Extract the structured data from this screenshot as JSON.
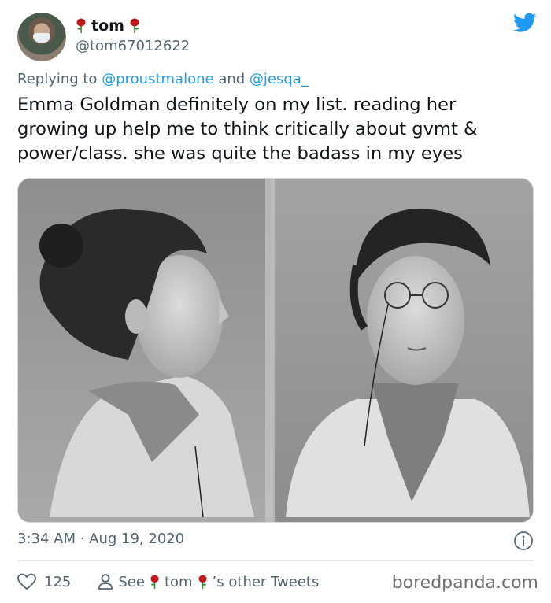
{
  "user": {
    "name": "tom",
    "handle": "@tom67012622",
    "avatar": "avatar-icon",
    "name_emoji": "rose-icon"
  },
  "reply": {
    "prefix": "Replying to",
    "mention1": "@proustmalone",
    "conjunction": "and",
    "mention2": "@jesqa_"
  },
  "tweet": {
    "lines": [
      "Emma Goldman definitely on my list.  reading her",
      "growing up help me to think critically about gvmt &",
      "power/class.  she was quite the badass in my eyes"
    ],
    "image": "photo-icon"
  },
  "meta": {
    "timestamp": "3:34 AM · Aug 19, 2020"
  },
  "actions": {
    "likes": "125",
    "see_prefix": "See",
    "see_name": "tom",
    "see_suffix": "’s other Tweets"
  },
  "watermark": "boredpanda.com",
  "colors": {
    "text": "#0f1419",
    "secondary": "#536471",
    "link": "#1d9bf0",
    "twitter_blue": "#1d9bf0",
    "rose": "#c21a1a"
  }
}
